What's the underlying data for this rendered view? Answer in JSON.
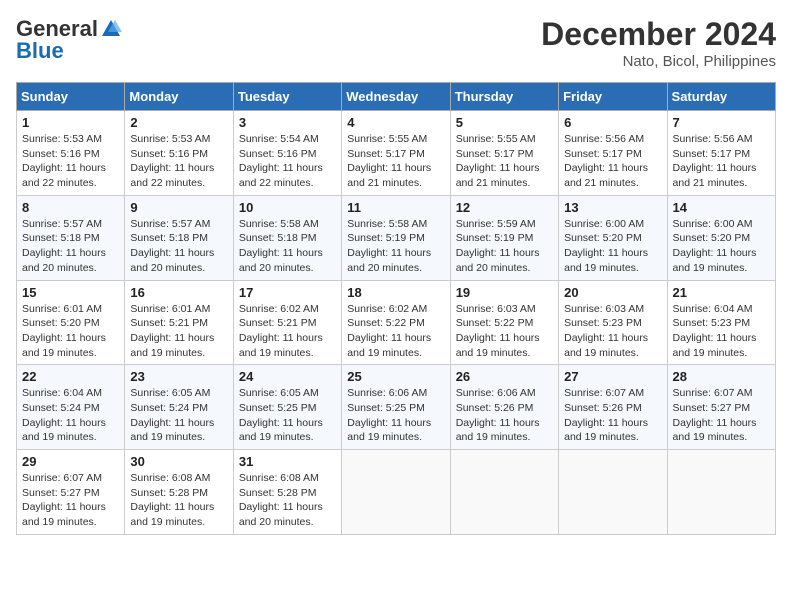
{
  "header": {
    "logo_line1": "General",
    "logo_line2": "Blue",
    "month": "December 2024",
    "location": "Nato, Bicol, Philippines"
  },
  "weekdays": [
    "Sunday",
    "Monday",
    "Tuesday",
    "Wednesday",
    "Thursday",
    "Friday",
    "Saturday"
  ],
  "weeks": [
    [
      {
        "day": "1",
        "info": "Sunrise: 5:53 AM\nSunset: 5:16 PM\nDaylight: 11 hours\nand 22 minutes."
      },
      {
        "day": "2",
        "info": "Sunrise: 5:53 AM\nSunset: 5:16 PM\nDaylight: 11 hours\nand 22 minutes."
      },
      {
        "day": "3",
        "info": "Sunrise: 5:54 AM\nSunset: 5:16 PM\nDaylight: 11 hours\nand 22 minutes."
      },
      {
        "day": "4",
        "info": "Sunrise: 5:55 AM\nSunset: 5:17 PM\nDaylight: 11 hours\nand 21 minutes."
      },
      {
        "day": "5",
        "info": "Sunrise: 5:55 AM\nSunset: 5:17 PM\nDaylight: 11 hours\nand 21 minutes."
      },
      {
        "day": "6",
        "info": "Sunrise: 5:56 AM\nSunset: 5:17 PM\nDaylight: 11 hours\nand 21 minutes."
      },
      {
        "day": "7",
        "info": "Sunrise: 5:56 AM\nSunset: 5:17 PM\nDaylight: 11 hours\nand 21 minutes."
      }
    ],
    [
      {
        "day": "8",
        "info": "Sunrise: 5:57 AM\nSunset: 5:18 PM\nDaylight: 11 hours\nand 20 minutes."
      },
      {
        "day": "9",
        "info": "Sunrise: 5:57 AM\nSunset: 5:18 PM\nDaylight: 11 hours\nand 20 minutes."
      },
      {
        "day": "10",
        "info": "Sunrise: 5:58 AM\nSunset: 5:18 PM\nDaylight: 11 hours\nand 20 minutes."
      },
      {
        "day": "11",
        "info": "Sunrise: 5:58 AM\nSunset: 5:19 PM\nDaylight: 11 hours\nand 20 minutes."
      },
      {
        "day": "12",
        "info": "Sunrise: 5:59 AM\nSunset: 5:19 PM\nDaylight: 11 hours\nand 20 minutes."
      },
      {
        "day": "13",
        "info": "Sunrise: 6:00 AM\nSunset: 5:20 PM\nDaylight: 11 hours\nand 19 minutes."
      },
      {
        "day": "14",
        "info": "Sunrise: 6:00 AM\nSunset: 5:20 PM\nDaylight: 11 hours\nand 19 minutes."
      }
    ],
    [
      {
        "day": "15",
        "info": "Sunrise: 6:01 AM\nSunset: 5:20 PM\nDaylight: 11 hours\nand 19 minutes."
      },
      {
        "day": "16",
        "info": "Sunrise: 6:01 AM\nSunset: 5:21 PM\nDaylight: 11 hours\nand 19 minutes."
      },
      {
        "day": "17",
        "info": "Sunrise: 6:02 AM\nSunset: 5:21 PM\nDaylight: 11 hours\nand 19 minutes."
      },
      {
        "day": "18",
        "info": "Sunrise: 6:02 AM\nSunset: 5:22 PM\nDaylight: 11 hours\nand 19 minutes."
      },
      {
        "day": "19",
        "info": "Sunrise: 6:03 AM\nSunset: 5:22 PM\nDaylight: 11 hours\nand 19 minutes."
      },
      {
        "day": "20",
        "info": "Sunrise: 6:03 AM\nSunset: 5:23 PM\nDaylight: 11 hours\nand 19 minutes."
      },
      {
        "day": "21",
        "info": "Sunrise: 6:04 AM\nSunset: 5:23 PM\nDaylight: 11 hours\nand 19 minutes."
      }
    ],
    [
      {
        "day": "22",
        "info": "Sunrise: 6:04 AM\nSunset: 5:24 PM\nDaylight: 11 hours\nand 19 minutes."
      },
      {
        "day": "23",
        "info": "Sunrise: 6:05 AM\nSunset: 5:24 PM\nDaylight: 11 hours\nand 19 minutes."
      },
      {
        "day": "24",
        "info": "Sunrise: 6:05 AM\nSunset: 5:25 PM\nDaylight: 11 hours\nand 19 minutes."
      },
      {
        "day": "25",
        "info": "Sunrise: 6:06 AM\nSunset: 5:25 PM\nDaylight: 11 hours\nand 19 minutes."
      },
      {
        "day": "26",
        "info": "Sunrise: 6:06 AM\nSunset: 5:26 PM\nDaylight: 11 hours\nand 19 minutes."
      },
      {
        "day": "27",
        "info": "Sunrise: 6:07 AM\nSunset: 5:26 PM\nDaylight: 11 hours\nand 19 minutes."
      },
      {
        "day": "28",
        "info": "Sunrise: 6:07 AM\nSunset: 5:27 PM\nDaylight: 11 hours\nand 19 minutes."
      }
    ],
    [
      {
        "day": "29",
        "info": "Sunrise: 6:07 AM\nSunset: 5:27 PM\nDaylight: 11 hours\nand 19 minutes."
      },
      {
        "day": "30",
        "info": "Sunrise: 6:08 AM\nSunset: 5:28 PM\nDaylight: 11 hours\nand 19 minutes."
      },
      {
        "day": "31",
        "info": "Sunrise: 6:08 AM\nSunset: 5:28 PM\nDaylight: 11 hours\nand 20 minutes."
      },
      {
        "day": "",
        "info": ""
      },
      {
        "day": "",
        "info": ""
      },
      {
        "day": "",
        "info": ""
      },
      {
        "day": "",
        "info": ""
      }
    ]
  ]
}
